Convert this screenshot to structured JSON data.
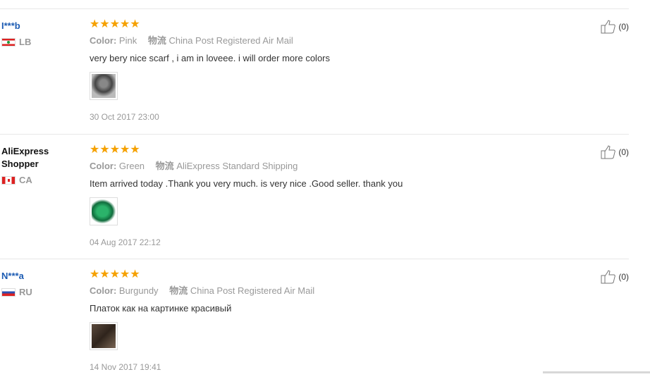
{
  "reviews": [
    {
      "user": "I***b",
      "country": "LB",
      "stars": "★★★★★",
      "color_label": "Color:",
      "color": "Pink",
      "shipping_label": "物流",
      "shipping": "China Post Registered Air Mail",
      "text": "very bery nice scarf , i am in loveee. i will order more colors",
      "date": "30 Oct 2017 23:00",
      "helpful": "(0)"
    },
    {
      "user": "AliExpress Shopper",
      "country": "CA",
      "stars": "★★★★★",
      "color_label": "Color:",
      "color": "Green",
      "shipping_label": "物流",
      "shipping": "AliExpress Standard Shipping",
      "text": "Item arrived today .Thank you very much. is very nice .Good seller. thank you",
      "date": "04 Aug 2017 22:12",
      "helpful": "(0)"
    },
    {
      "user": "N***a",
      "country": "RU",
      "stars": "★★★★★",
      "color_label": "Color:",
      "color": "Burgundy",
      "shipping_label": "物流",
      "shipping": "China Post Registered Air Mail",
      "text": "Платок как на картинке красивый",
      "date": "14 Nov 2017 19:41",
      "helpful": "(0)"
    }
  ],
  "icons": {
    "helpful": "thumbs-up-icon",
    "star": "star-icon"
  },
  "colors": {
    "username": "#1d5cb3",
    "star": "#f5a100",
    "meta": "#999999"
  }
}
